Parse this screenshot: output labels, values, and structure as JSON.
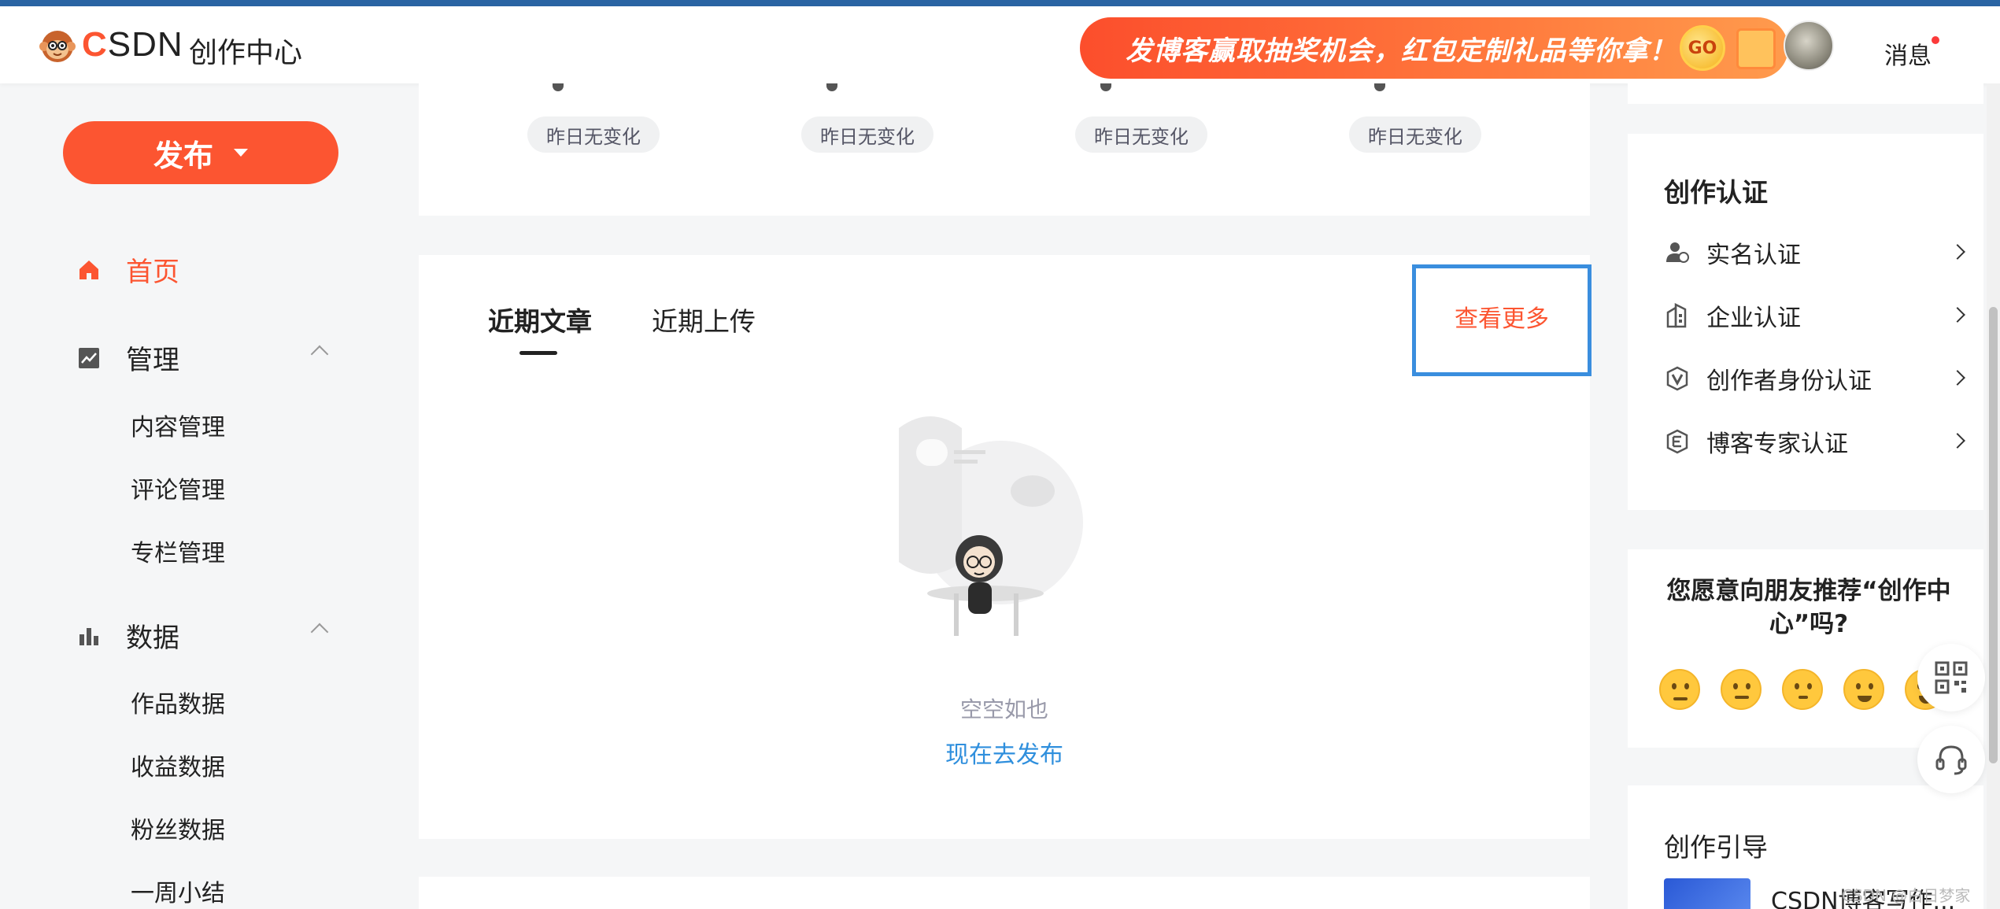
{
  "header": {
    "logo_text": "CSDN",
    "center_title": "创作中心",
    "banner_text": "发博客赢取抽奖机会，红包定制礼品等你拿！",
    "banner_go": "GO",
    "messages_label": "消息"
  },
  "sidebar": {
    "publish_label": "发布",
    "home_label": "首页",
    "manage": {
      "label": "管理",
      "items": [
        "内容管理",
        "评论管理",
        "专栏管理"
      ]
    },
    "data": {
      "label": "数据",
      "items": [
        "作品数据",
        "收益数据",
        "粉丝数据",
        "一周小结"
      ]
    }
  },
  "stats": {
    "changes": [
      "昨日无变化",
      "昨日无变化",
      "昨日无变化",
      "昨日无变化"
    ]
  },
  "articles": {
    "tabs": [
      "近期文章",
      "近期上传"
    ],
    "active_tab": "近期文章",
    "see_more": "查看更多",
    "empty_text": "空空如也",
    "publish_now": "现在去发布"
  },
  "certification": {
    "title": "创作认证",
    "items": [
      {
        "label": "实名认证",
        "icon": "user-verify-icon"
      },
      {
        "label": "企业认证",
        "icon": "building-icon"
      },
      {
        "label": "创作者身份认证",
        "icon": "shield-v-icon"
      },
      {
        "label": "博客专家认证",
        "icon": "expert-badge-icon"
      }
    ]
  },
  "recommend": {
    "question": "您愿意向朋友推荐“创作中心”吗?",
    "emojis": [
      "angry-face-icon",
      "confused-face-icon",
      "neutral-face-icon",
      "happy-face-icon",
      "grinning-face-icon"
    ]
  },
  "guide": {
    "title": "创作引导",
    "item": "CSDN博客写作..."
  },
  "watermark": "CSDN @白日梦家",
  "colors": {
    "accent": "#fc5531",
    "link": "#2f8fdd",
    "highlight_border": "#3a8ede"
  }
}
